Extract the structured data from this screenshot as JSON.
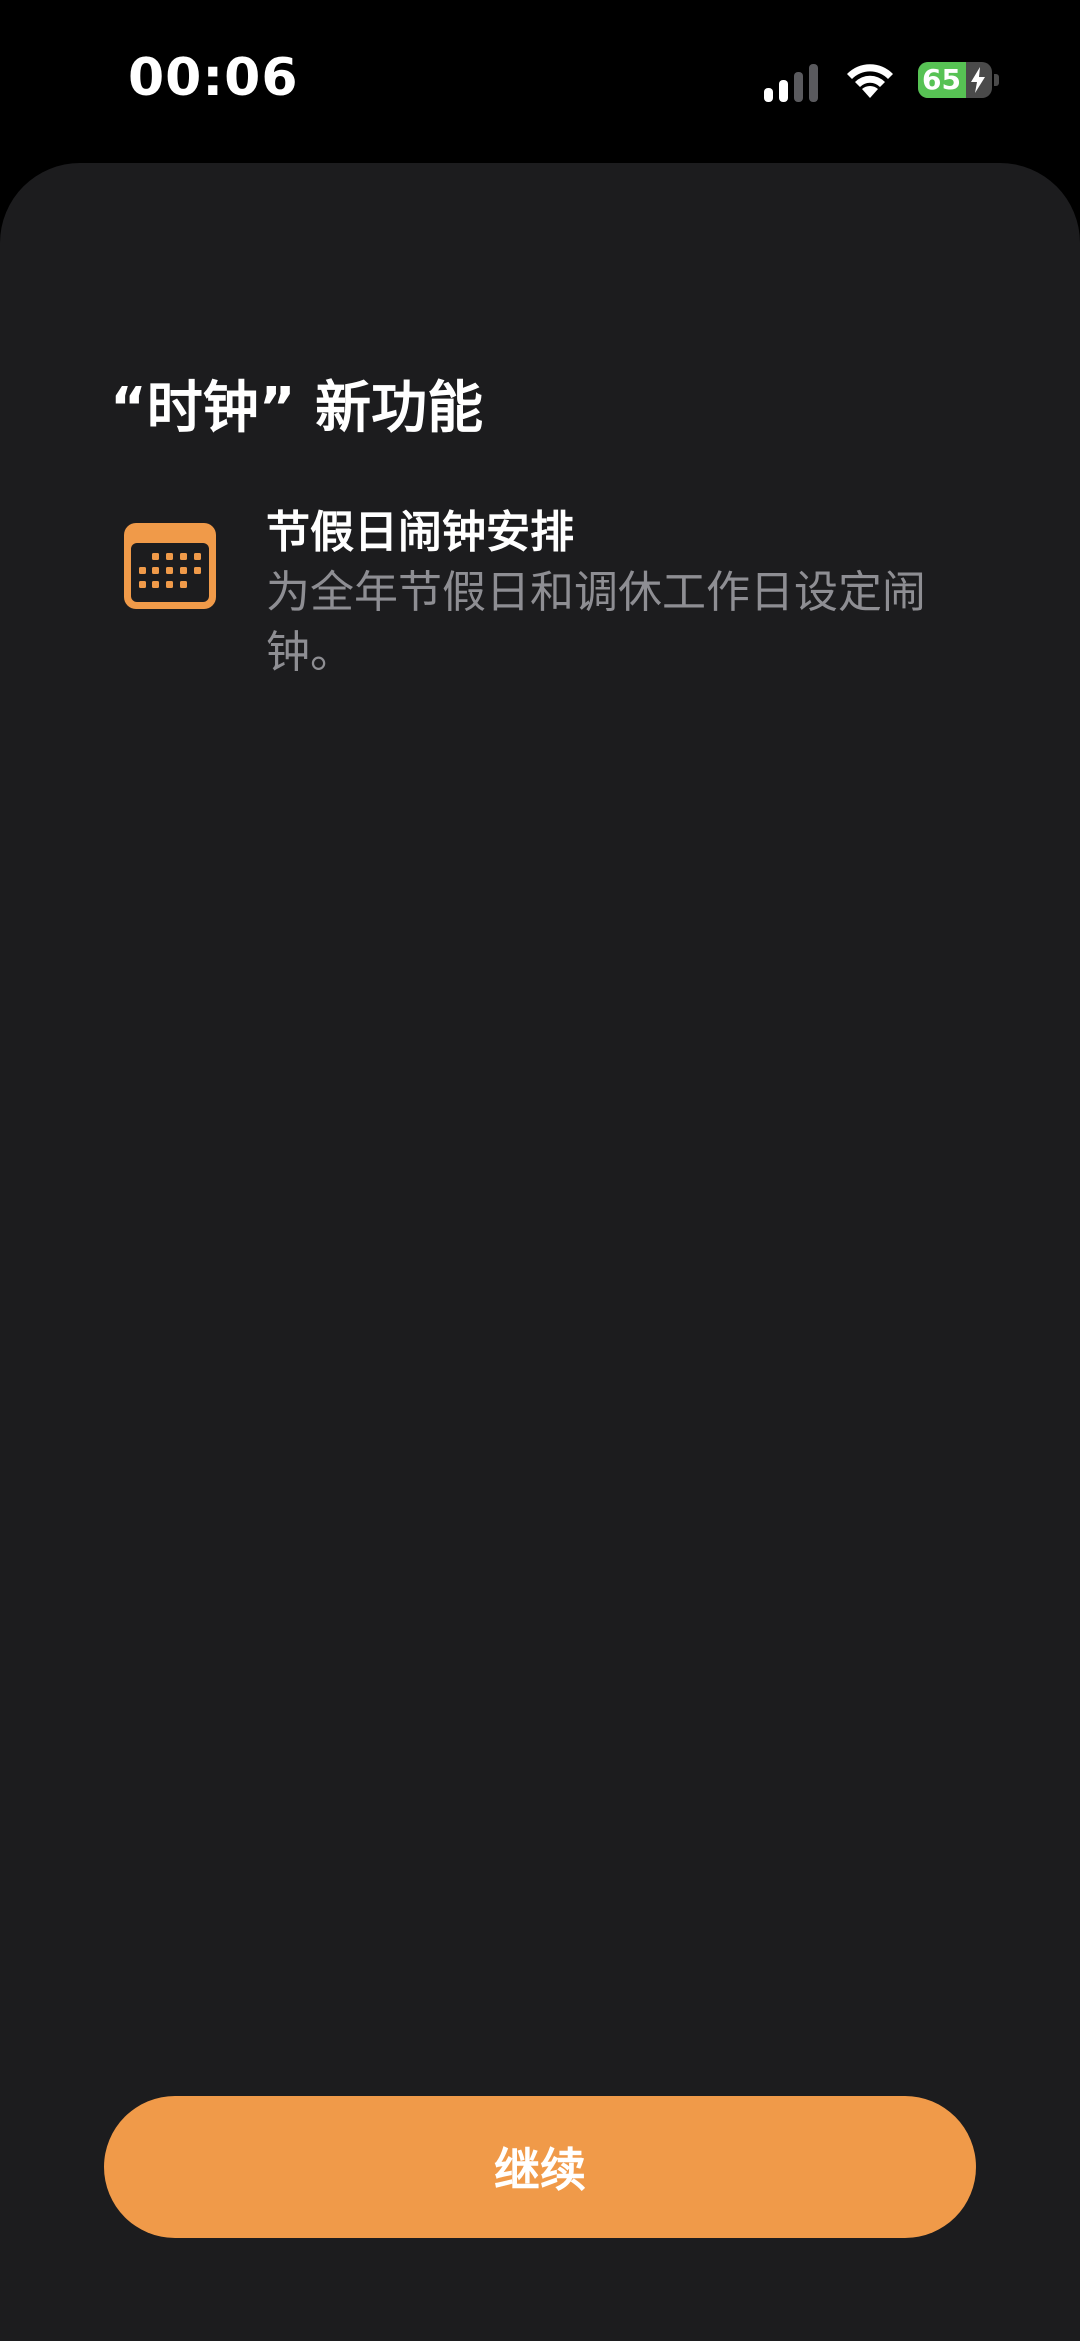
{
  "status_bar": {
    "time": "00:06",
    "battery_level": "65",
    "battery_fraction": 0.65,
    "charging": true,
    "signal_icon": "cellular-signal-icon",
    "wifi_icon": "wifi-icon",
    "battery_icon": "battery-charging-icon"
  },
  "sheet": {
    "title": "“时钟” 新功能",
    "features": [
      {
        "icon": "calendar-icon",
        "title": "节假日闹钟安排",
        "description": "为全年节假日和调休工作日设定闹钟。"
      }
    ],
    "continue_label": "继续"
  },
  "colors": {
    "background": "#000000",
    "sheet_background": "#1c1c1e",
    "accent": "#f09a49",
    "primary_text": "#ffffff",
    "secondary_text": "#8e8e93",
    "battery_green": "#57c254"
  }
}
